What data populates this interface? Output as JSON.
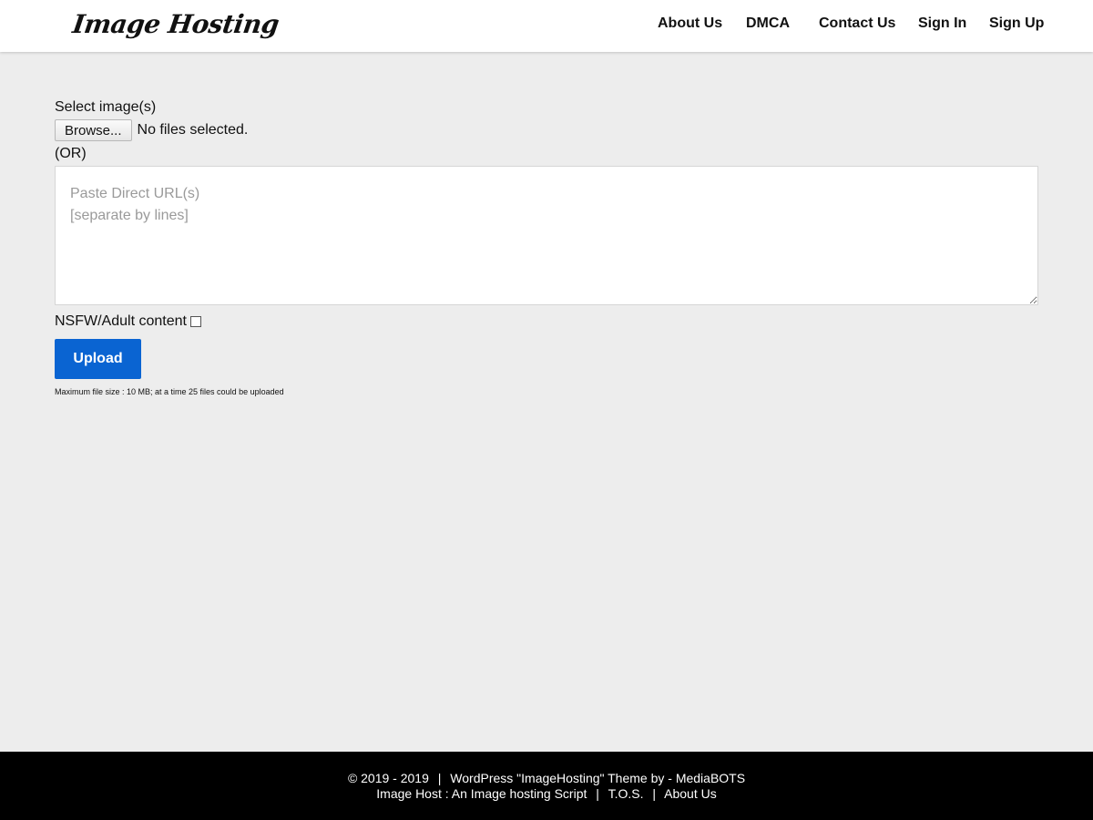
{
  "header": {
    "logo_text": "Image Hosting",
    "nav": [
      "About Us",
      "DMCA",
      "Contact Us",
      "Sign In",
      "Sign Up"
    ]
  },
  "upload_form": {
    "select_label": "Select image(s)",
    "browse_label": "Browse...",
    "file_status": "No files selected.",
    "or_label": "(OR)",
    "url_placeholder": "Paste Direct URL(s)\n[separate by lines]",
    "nsfw_label": "NSFW/Adult content",
    "nsfw_checked": false,
    "upload_label": "Upload",
    "size_note": "Maximum file size : 10 MB; at a time 25 files could be uploaded"
  },
  "footer": {
    "copyright": "© 2019 - 2019",
    "theme_credit": "WordPress \"ImageHosting\" Theme by - MediaBOTS",
    "script_credit": "Image Host : An Image hosting Script",
    "tos_link": "T.O.S.",
    "about_link": "About Us",
    "separator": "|"
  },
  "colors": {
    "page_bg": "#ededed",
    "header_bg": "#ffffff",
    "upload_button": "#0a64d2",
    "footer_bg": "#000000"
  }
}
